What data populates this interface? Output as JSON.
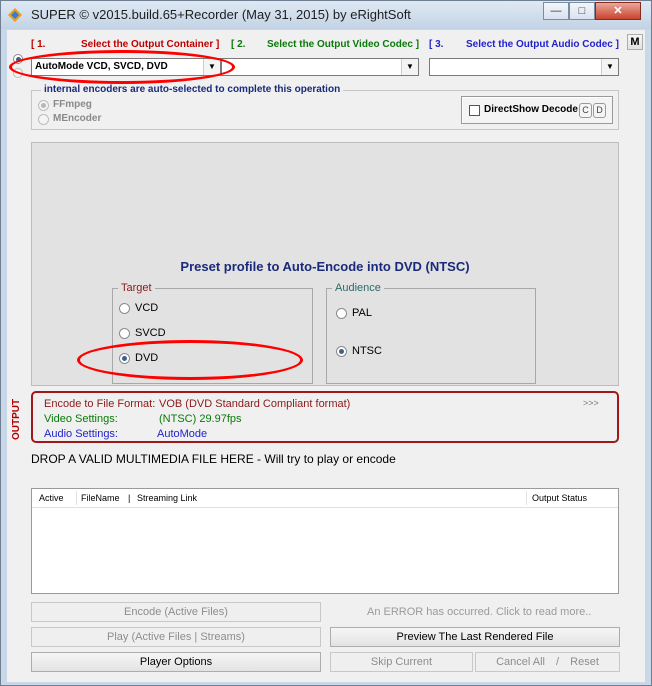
{
  "window": {
    "title": "SUPER © v2015.build.65+Recorder (May 31, 2015) by eRightSoft",
    "minimize_glyph": "—",
    "maximize_glyph": "□",
    "close_glyph": "✕"
  },
  "step1": {
    "num": "[ 1.",
    "label": "Select the Output Container ]",
    "value": "AutoMode VCD, SVCD, DVD"
  },
  "step2": {
    "num": "[ 2.",
    "label": "Select the Output Video Codec ]",
    "value": ""
  },
  "step3": {
    "num": "[ 3.",
    "label": "Select the Output Audio Codec ]",
    "value": ""
  },
  "m_button": "M",
  "encoders": {
    "note": "internal encoders are auto-selected to complete this operation",
    "options": [
      "FFmpeg",
      "MEncoder"
    ],
    "directshow_label": "DirectShow Decode",
    "c_label": "C",
    "d_label": "D"
  },
  "preset": {
    "title": "Preset profile to Auto-Encode into DVD  (NTSC)",
    "target_legend": "Target",
    "target_options": [
      "VCD",
      "SVCD",
      "DVD"
    ],
    "target_selected": "DVD",
    "audience_legend": "Audience",
    "audience_options": [
      "PAL",
      "NTSC"
    ],
    "audience_selected": "NTSC"
  },
  "output": {
    "side_label": "OUTPUT",
    "format_key": "Encode to File Format:",
    "format_val": "VOB (DVD Standard Compliant format)",
    "video_key": "Video Settings:",
    "video_val": "(NTSC) 29.97fps",
    "audio_key": "Audio Settings:",
    "audio_val": "AutoMode",
    "more": ">>>"
  },
  "drop_text": "DROP A VALID MULTIMEDIA FILE HERE - Will try to play or encode",
  "file_list": {
    "columns": [
      "Active",
      "FileName",
      "|",
      "Streaming Link",
      "Output Status"
    ]
  },
  "buttons": {
    "encode": "Encode (Active Files)",
    "error": "An ERROR has occurred. Click to read more..",
    "play": "Play (Active Files | Streams)",
    "preview": "Preview The Last Rendered File",
    "player_options": "Player Options",
    "skip": "Skip Current",
    "cancel_all": "Cancel All",
    "slash": "/",
    "reset": "Reset"
  },
  "colors": {
    "red_label": "#c00000",
    "green_label": "#0a7a0a",
    "blue_label": "#2222cc",
    "navy_title": "#1a2a7a",
    "highlight_ellipse": "#ff0000"
  }
}
